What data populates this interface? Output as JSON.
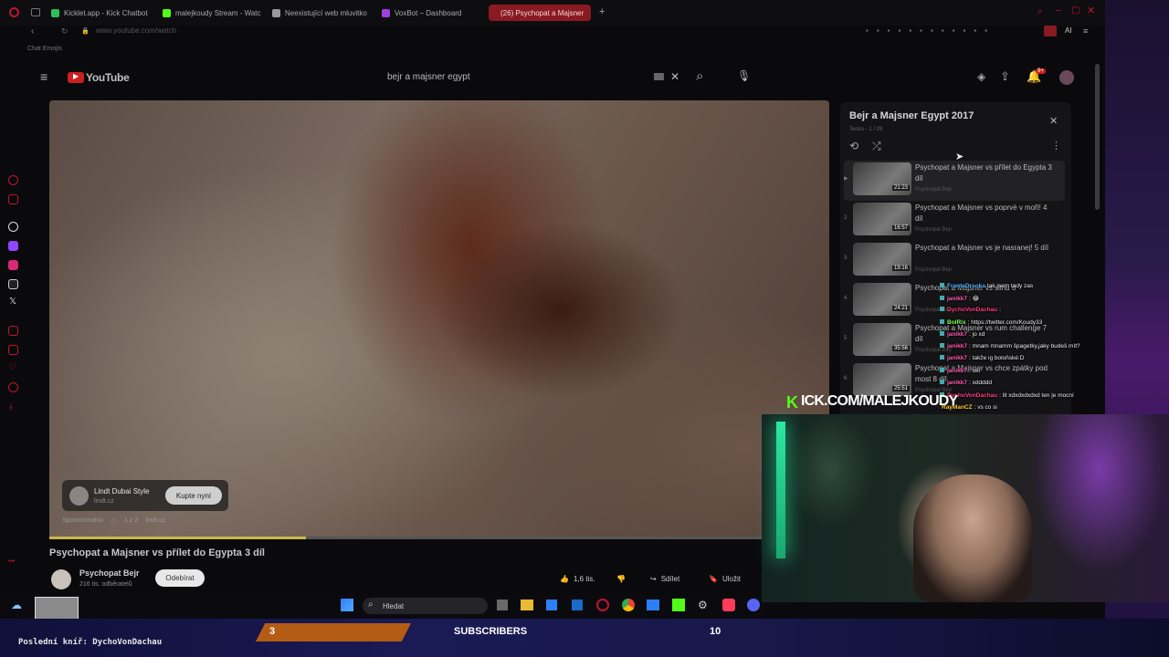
{
  "tabs": [
    {
      "label": "Kicklet.app - Kick Chatbot",
      "color": "#2dbd5a"
    },
    {
      "label": "malejkoudy Stream - Watc",
      "color": "#53fc18"
    },
    {
      "label": "Neexistující web mluvitko",
      "color": "#999999"
    },
    {
      "label": "VoxBot – Dashboard",
      "color": "#a040e0"
    },
    {
      "label": "(26) Psychopat a Majsner",
      "color": "#ff3d3d"
    }
  ],
  "browser": {
    "url": "www.youtube.com/watch",
    "bookmark": "Chat Emojis"
  },
  "youtube": {
    "logo": "YouTube",
    "search_query": "bejr a majsner egypt",
    "notification_badge": "9+"
  },
  "player": {
    "ad_title": "Lindt Dubai Style",
    "ad_domain": "lindt.cz",
    "ad_button": "Kupte nyní",
    "ad_sponsored": "Sponzorováno",
    "ad_count": "1 z 2",
    "ad_site": "lindt.cz",
    "progress_fraction": 0.36
  },
  "video": {
    "title": "Psychopat a Majsner vs přílet do Egypta 3 díl",
    "channel": "Psychopat Bejr",
    "subscribers": "216 tis. odběratelů",
    "subscribe_label": "Odebírat",
    "likes": "1,6 tis.",
    "share_label": "Sdílet",
    "save_label": "Uložit"
  },
  "playlist": {
    "title": "Bejr a Majsner Egypt 2017",
    "subtitle": "Tenco - 1 / 29",
    "items": [
      {
        "index": "▶",
        "title": "Psychopat a Majsner vs přílet do Egypta 3 díl",
        "channel": "Psychopat Bejr",
        "duration": "21:23"
      },
      {
        "index": "2",
        "title": "Psychopat a Majsner vs poprvé v moři! 4 díl",
        "channel": "Psychopat Bejr",
        "duration": "16:57"
      },
      {
        "index": "3",
        "title": "Psychopat a Majsner vs je nasranej! 5 díl",
        "channel": "Psychopat Bejr",
        "duration": "19:16"
      },
      {
        "index": "4",
        "title": "Psychopat a Majsner vs silnu 6",
        "channel": "Psychopat Bejr",
        "duration": "24:21"
      },
      {
        "index": "5",
        "title": "Psychopat a Majsner vs rum challenge 7 díl",
        "channel": "Psychopat Bejr",
        "duration": "35:56"
      },
      {
        "index": "6",
        "title": "Psychopat a Majsner vs chce zpátky pod most 8 díl",
        "channel": "Psychopat Bejr",
        "duration": "25:51"
      }
    ]
  },
  "chat": [
    {
      "user": "FrantaDrsoka",
      "color": "#4ab0ff",
      "text": "tak jsem tady zas"
    },
    {
      "user": "janikk7",
      "color": "#ff5ab4",
      "text": ": 😂"
    },
    {
      "user": "DychoVonDachau",
      "color": "#ff3d7a",
      "text": ":"
    },
    {
      "user": "BolRix",
      "color": "#8aff5a",
      "text": ": https://twitter.com/Koudy33"
    },
    {
      "user": "janikk7",
      "color": "#ff5ab4",
      "text": ": jo xd"
    },
    {
      "user": "janikk7",
      "color": "#ff5ab4",
      "text": ": mnam mnamm špagetky,jaky budeš mít?"
    },
    {
      "user": "janikk7",
      "color": "#ff5ab4",
      "text": ": takže ig boloňské:D"
    },
    {
      "user": "janikk7",
      "color": "#ff5ab4",
      "text": ": oki"
    },
    {
      "user": "janikk7",
      "color": "#ff5ab4",
      "text": ": xddddd"
    },
    {
      "user": "DychoVonDachau",
      "color": "#ff3d7a",
      "text": ": lit xdxdxdxdxd ten je mocní"
    },
    {
      "user": "RayManCZ",
      "color": "#ffcc33",
      "text": ": vs co si"
    }
  ],
  "overlay": {
    "kick_k": "K",
    "kick_url": "ICK.COM/MALEJKOUDY",
    "last_tip_label": "Poslední kníř: DychoVonDachau",
    "subs_count": "3",
    "subs_label": "SUBSCRIBERS",
    "subs_goal": "10"
  },
  "taskbar": {
    "search_label": "Hledat"
  }
}
